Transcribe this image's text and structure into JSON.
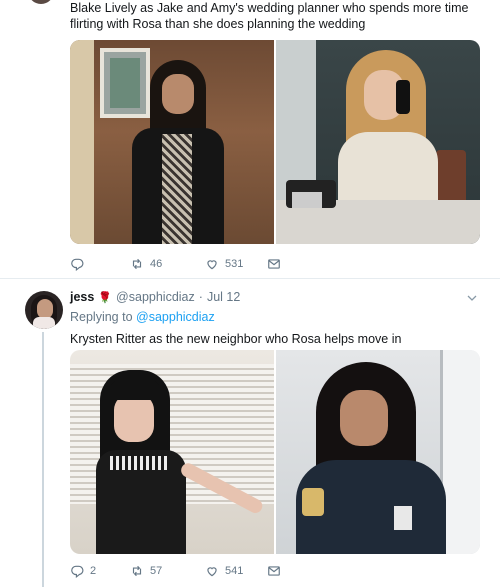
{
  "tweet1": {
    "text": "Blake Lively as Jake and Amy's wedding planner who spends more time flirting with Rosa than she does planning the wedding",
    "actions": {
      "reply_count": "",
      "retweet_count": "46",
      "like_count": "531"
    }
  },
  "tweet2": {
    "name": "jess",
    "emoji": "🌹",
    "handle": "@sapphicdiaz",
    "separator": "·",
    "date": "Jul 12",
    "replying_prefix": "Replying to",
    "replying_handle": "@sapphicdiaz",
    "text": "Krysten Ritter as the new neighbor who Rosa helps move in",
    "actions": {
      "reply_count": "2",
      "retweet_count": "57",
      "like_count": "541"
    }
  },
  "colors": {
    "text": "#14171a",
    "muted": "#657786",
    "link": "#1da1f2",
    "divider": "#e6ecf0",
    "rose": "#e0245e"
  },
  "icons": [
    "reply-icon",
    "retweet-icon",
    "like-icon",
    "direct-message-icon",
    "caret-down-icon",
    "rose-icon"
  ]
}
